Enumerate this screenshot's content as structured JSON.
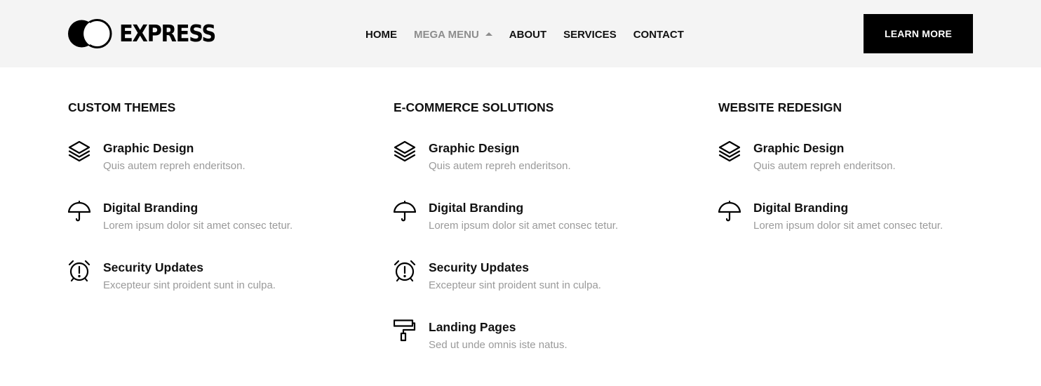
{
  "brand": {
    "name": "EXPRESS",
    "icon": "two-circles-logo-icon"
  },
  "nav": {
    "items": [
      {
        "label": "HOME"
      },
      {
        "label": "MEGA MENU",
        "active": true,
        "icon": "caret-up-icon"
      },
      {
        "label": "ABOUT"
      },
      {
        "label": "SERVICES"
      },
      {
        "label": "CONTACT"
      }
    ],
    "cta_label": "LEARN MORE"
  },
  "colors": {
    "header_bg": "#f4f4f4",
    "cta_bg": "#000000",
    "active_nav": "#8d8d8d",
    "muted_text": "#9a9a9a"
  },
  "columns": [
    {
      "title": "CUSTOM THEMES",
      "items": [
        {
          "title": "Graphic Design",
          "desc": "Quis autem repreh enderitson.",
          "icon": "layers-icon"
        },
        {
          "title": "Digital Branding",
          "desc": "Lorem ipsum dolor sit amet consec tetur.",
          "icon": "umbrella-icon"
        },
        {
          "title": "Security Updates",
          "desc": "Excepteur sint proident sunt in culpa.",
          "icon": "alarm-clock-icon"
        }
      ]
    },
    {
      "title": "E-COMMERCE SOLUTIONS",
      "items": [
        {
          "title": "Graphic Design",
          "desc": "Quis autem repreh enderitson.",
          "icon": "layers-icon"
        },
        {
          "title": "Digital Branding",
          "desc": "Lorem ipsum dolor sit amet consec tetur.",
          "icon": "umbrella-icon"
        },
        {
          "title": "Security Updates",
          "desc": "Excepteur sint proident sunt in culpa.",
          "icon": "alarm-clock-icon"
        },
        {
          "title": "Landing Pages",
          "desc": "Sed ut unde omnis iste natus.",
          "icon": "paint-roller-icon"
        }
      ]
    },
    {
      "title": "WEBSITE REDESIGN",
      "items": [
        {
          "title": "Graphic Design",
          "desc": "Quis autem repreh enderitson.",
          "icon": "layers-icon"
        },
        {
          "title": "Digital Branding",
          "desc": "Lorem ipsum dolor sit amet consec tetur.",
          "icon": "umbrella-icon"
        }
      ]
    }
  ]
}
